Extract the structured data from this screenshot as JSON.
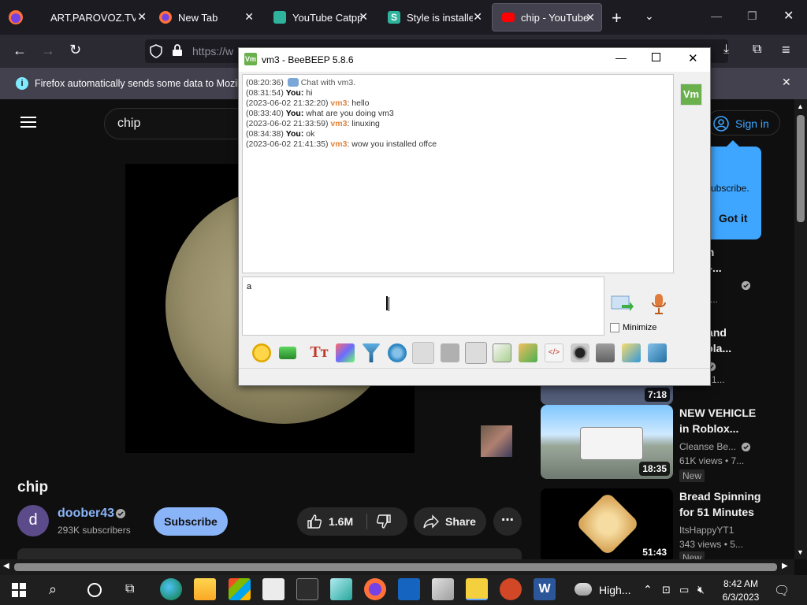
{
  "browser": {
    "tabs": [
      {
        "label": "ART.PAROVOZ.TV-P...",
        "icon": "firefox-icon"
      },
      {
        "label": "New Tab",
        "icon": "firefox-icon"
      },
      {
        "label": "YouTube Catppu...",
        "icon": "stylus-icon"
      },
      {
        "label": "Style is installed",
        "icon": "stylus-s-icon"
      },
      {
        "label": "chip - YouTube",
        "icon": "youtube-icon"
      }
    ],
    "url": "https://w",
    "notification": "Firefox automatically sends some data to Mozilla"
  },
  "youtube": {
    "search_value": "chip",
    "sign_in": "Sign in",
    "tooltip_text": "ubscribe.",
    "tooltip_button": "Got it",
    "video_title": "chip",
    "channel": {
      "avatar_letter": "d",
      "name": "doober43",
      "subscribers": "293K subscribers"
    },
    "subscribe_label": "Subscribe",
    "likes": "1.6M",
    "share_label": "Share",
    "recommended": [
      {
        "title_line1": "ussian",
        "title_line2": "ction -...",
        "channel": "mplifi...",
        "meta": "ews • 2..."
      },
      {
        "title_line1": "lessi and",
        "title_line2": "uardiola...",
        "channel": "",
        "meta": "views • 1...",
        "duration": "7:18"
      },
      {
        "title_line1": "NEW VEHICLE",
        "title_line2": "in Roblox...",
        "channel": "Cleanse Be...",
        "meta": "61K views • 7...",
        "duration": "18:35",
        "badge": "New"
      },
      {
        "title_line1": "Bread Spinning",
        "title_line2": "for 51 Minutes",
        "channel": "ItsHappyYT1",
        "meta": "343 views • 5...",
        "duration": "51:43",
        "badge": "New"
      }
    ]
  },
  "beebeep": {
    "window_title": "vm3 - BeeBEEP 5.8.6",
    "avatar_label": "Vm",
    "chat": [
      {
        "ts": "(08:20:36)",
        "sender": "",
        "text": "Chat with vm3.",
        "system": true
      },
      {
        "ts": "(08:31:54)",
        "sender": "You",
        "text": "hi"
      },
      {
        "ts": "(2023-06-02 21:32:20)",
        "sender": "vm3",
        "text": "hello"
      },
      {
        "ts": "(08:33:40)",
        "sender": "You",
        "text": "what are you doing vm3"
      },
      {
        "ts": "(2023-06-02 21:33:59)",
        "sender": "vm3",
        "text": "linuxing"
      },
      {
        "ts": "(08:34:38)",
        "sender": "You",
        "text": "ok"
      },
      {
        "ts": "(2023-06-02 21:41:35)",
        "sender": "vm3",
        "text": "wow you installed offce"
      }
    ],
    "input_value": "a",
    "minimize_label": "Minimize"
  },
  "taskbar": {
    "weather": "High...",
    "time": "8:42 AM",
    "date": "6/3/2023"
  },
  "colors": {
    "youtube_bg": "#0f0f0f",
    "beebeep_accent": "#e0843c",
    "link_blue": "#3ea6ff"
  }
}
